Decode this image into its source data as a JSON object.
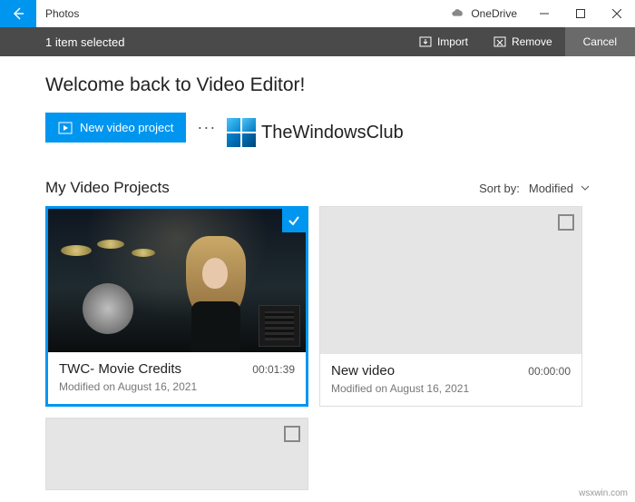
{
  "titlebar": {
    "app_name": "Photos",
    "onedrive_label": "OneDrive"
  },
  "toolbar": {
    "selection_text": "1 item selected",
    "import_label": "Import",
    "remove_label": "Remove",
    "cancel_label": "Cancel"
  },
  "main": {
    "welcome": "Welcome back to Video Editor!",
    "new_project_label": "New video project",
    "more_label": "···",
    "watermark_text": "TheWindowsClub",
    "section_title": "My Video Projects",
    "sort_label": "Sort by:",
    "sort_value": "Modified"
  },
  "projects": [
    {
      "title": "TWC- Movie Credits",
      "duration": "00:01:39",
      "modified": "Modified on August 16, 2021",
      "selected": true,
      "has_thumb": true
    },
    {
      "title": "New video",
      "duration": "00:00:00",
      "modified": "Modified on August 16, 2021",
      "selected": false,
      "has_thumb": false
    }
  ],
  "footer": {
    "site": "wsxwin.com"
  }
}
